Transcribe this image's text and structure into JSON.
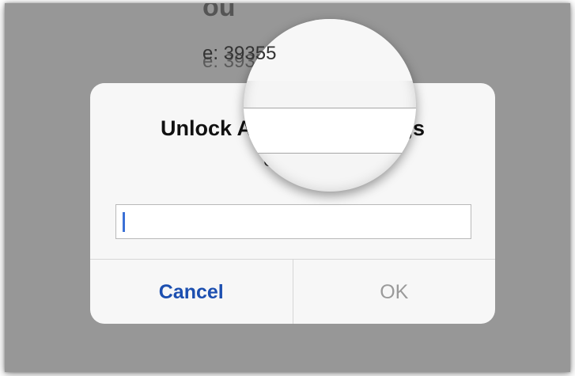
{
  "background_screen": {
    "code_text": "e: 39355"
  },
  "alert": {
    "title_left": "Unlock A",
    "title_right": "ngs",
    "message": "Coo",
    "input_value": "",
    "cancel_label": "Cancel",
    "ok_label": "OK"
  },
  "colors": {
    "dim_background": "#979797",
    "alert_background": "#f7f7f7",
    "accent": "#1c4fb0",
    "disabled": "#9a9a9a",
    "caret": "#3b70d6"
  }
}
